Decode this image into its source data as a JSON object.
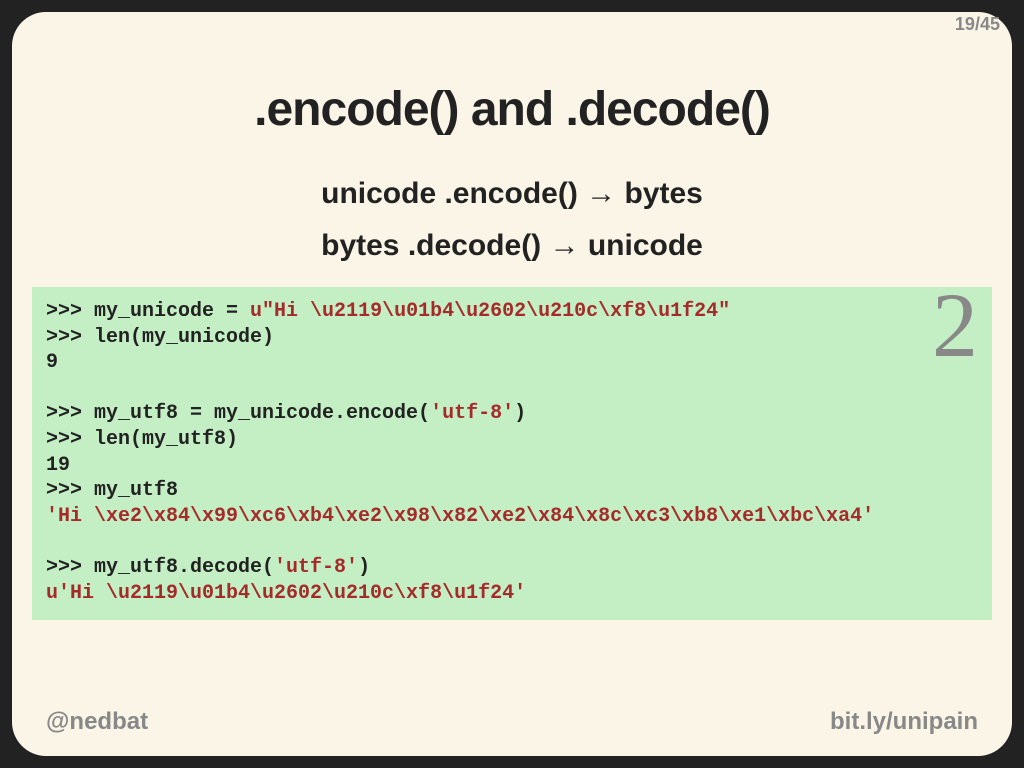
{
  "page": {
    "current": "19",
    "total": "45"
  },
  "title": ".encode() and .decode()",
  "sub1": "unicode .encode() → bytes",
  "sub2": "bytes .decode() → unicode",
  "python_version_badge": "2",
  "code": {
    "l1a": ">>> my_unicode = ",
    "l1b": "u\"Hi \\u2119\\u01b4\\u2602\\u210c\\xf8\\u1f24\"",
    "l2": ">>> len(my_unicode)",
    "l3": "9",
    "l4": "",
    "l5a": ">>> my_utf8 = my_unicode.encode(",
    "l5b": "'utf-8'",
    "l5c": ")",
    "l6": ">>> len(my_utf8)",
    "l7": "19",
    "l8": ">>> my_utf8",
    "l9": "'Hi \\xe2\\x84\\x99\\xc6\\xb4\\xe2\\x98\\x82\\xe2\\x84\\x8c\\xc3\\xb8\\xe1\\xbc\\xa4'",
    "l10": "",
    "l11a": ">>> my_utf8.decode(",
    "l11b": "'utf-8'",
    "l11c": ")",
    "l12": "u'Hi \\u2119\\u01b4\\u2602\\u210c\\xf8\\u1f24'"
  },
  "footer": {
    "left": "@nedbat",
    "right": "bit.ly/unipain"
  }
}
